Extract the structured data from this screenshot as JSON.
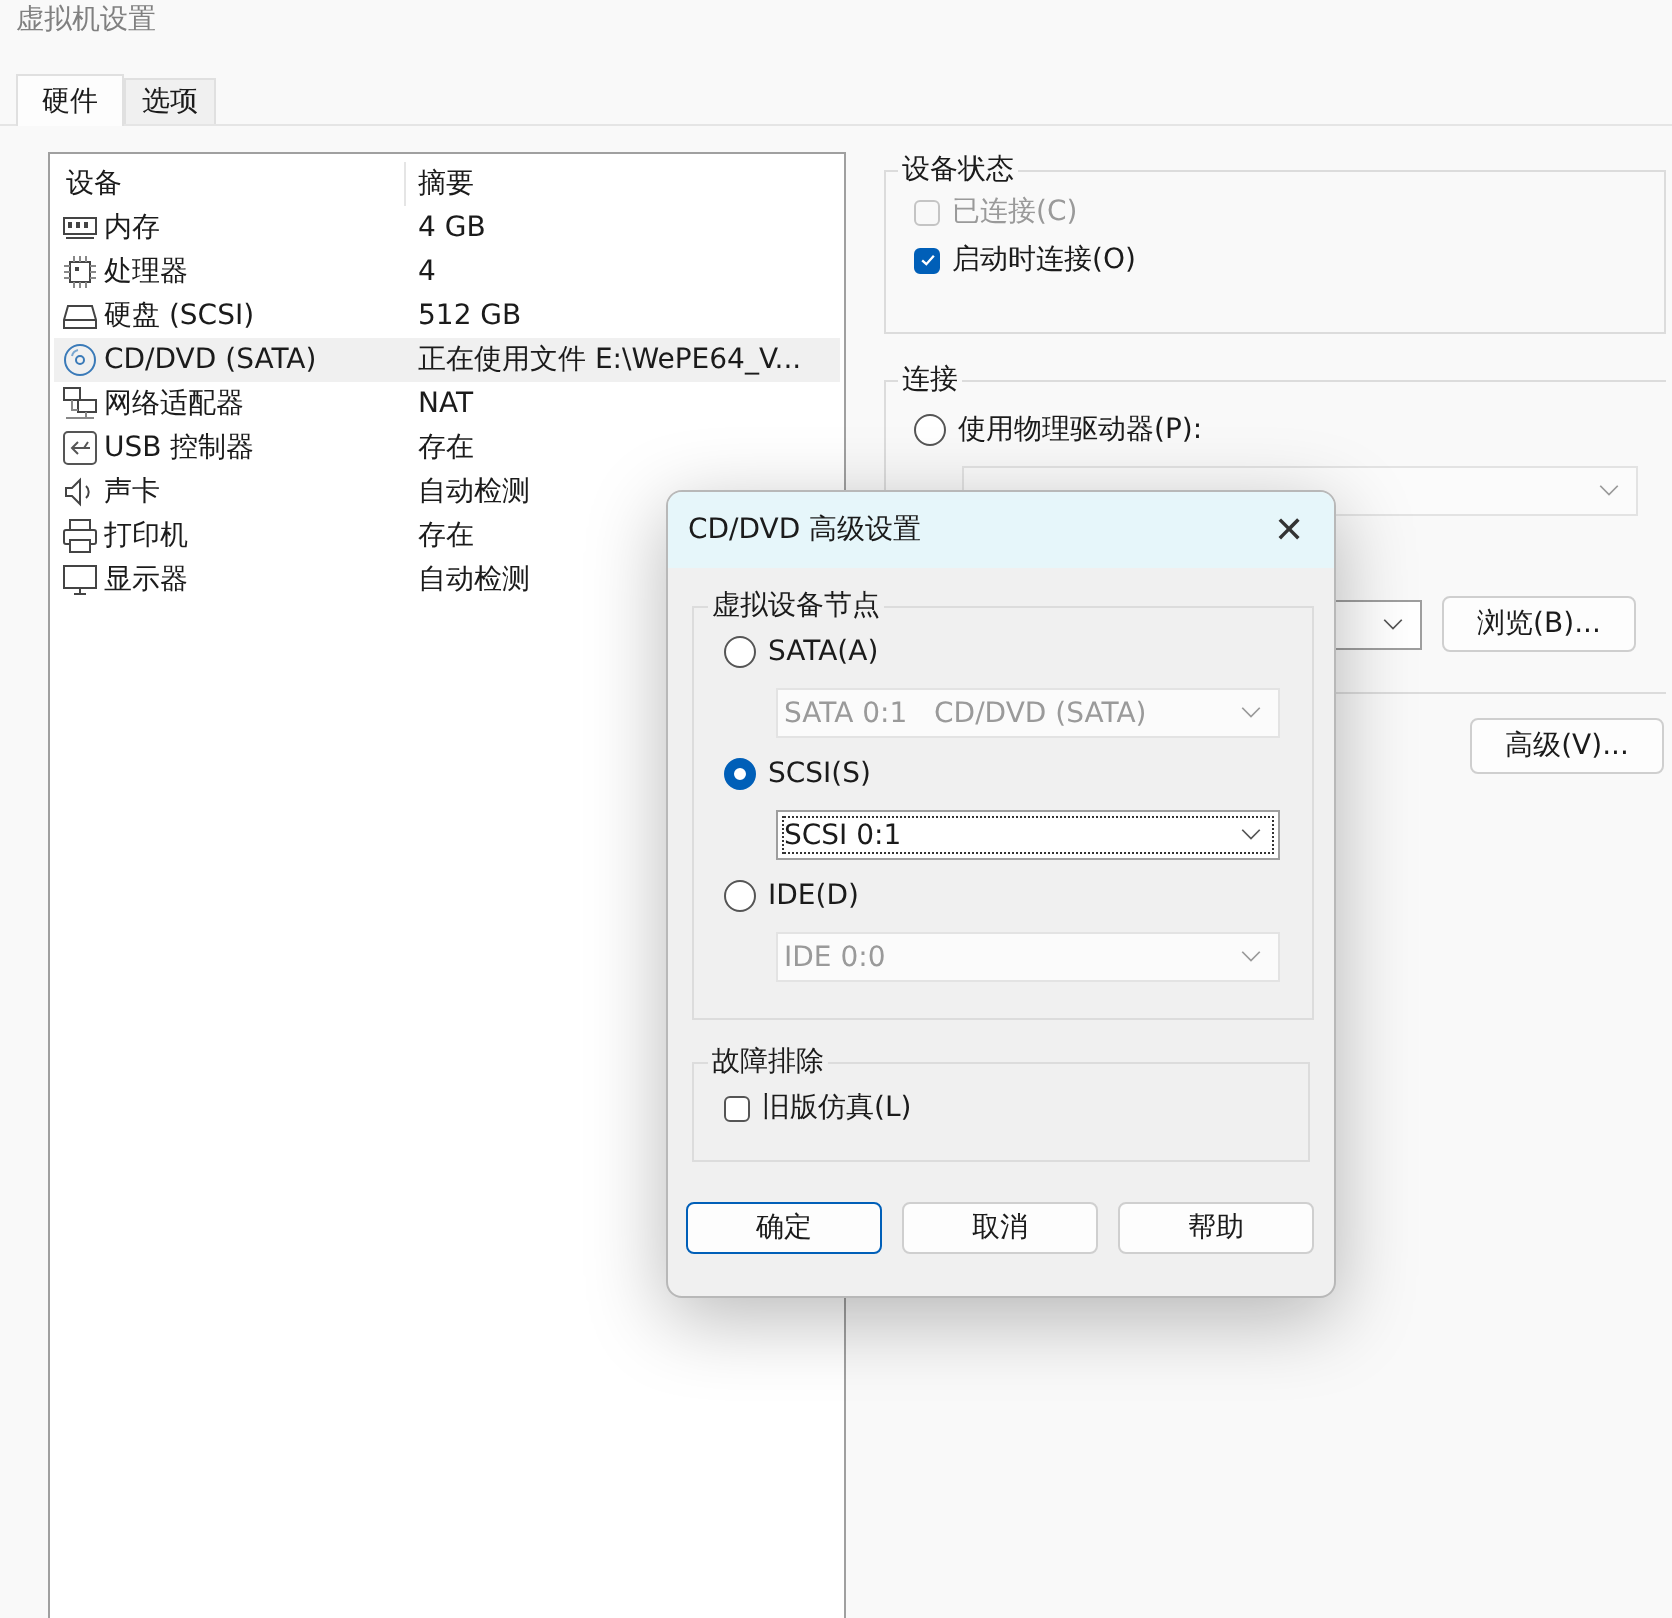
{
  "window": {
    "title": "虚拟机设置"
  },
  "tabs": [
    {
      "label": "硬件",
      "selected": true
    },
    {
      "label": "选项",
      "selected": false
    }
  ],
  "device_table": {
    "columns": [
      "设备",
      "摘要"
    ],
    "rows": [
      {
        "device": "内存",
        "summary": "4 GB",
        "selected": false
      },
      {
        "device": "处理器",
        "summary": "4",
        "selected": false
      },
      {
        "device": "硬盘 (SCSI)",
        "summary": "512 GB",
        "selected": false
      },
      {
        "device": "CD/DVD (SATA)",
        "summary": "正在使用文件 E:\\WePE64_V...",
        "selected": true
      },
      {
        "device": "网络适配器",
        "summary": "NAT",
        "selected": false
      },
      {
        "device": "USB 控制器",
        "summary": "存在",
        "selected": false
      },
      {
        "device": "声卡",
        "summary": "自动检测",
        "selected": false
      },
      {
        "device": "打印机",
        "summary": "存在",
        "selected": false
      },
      {
        "device": "显示器",
        "summary": "自动检测",
        "selected": false
      }
    ]
  },
  "device_status": {
    "title": "设备状态",
    "options": [
      {
        "label": "已连接(C)",
        "checked": false,
        "disabled": true
      },
      {
        "label": "启动时连接(O)",
        "checked": true,
        "disabled": false
      }
    ]
  },
  "connection": {
    "title": "连接",
    "physical_drive": {
      "label": "使用物理驱动器(P):",
      "selected": false
    },
    "drive_select": {
      "disabled": true
    },
    "browse_button": "浏览(B)..."
  },
  "advanced_button": "高级(V)...",
  "dialog": {
    "title": "CD/DVD 高级设置",
    "close": "✕",
    "node_group": {
      "title": "虚拟设备节点",
      "options": [
        {
          "label": "SATA(A)",
          "selected": false,
          "value": "SATA 0:1   CD/DVD (SATA)",
          "disabled": true
        },
        {
          "label": "SCSI(S)",
          "selected": true,
          "value": "SCSI 0:1",
          "disabled": false
        },
        {
          "label": "IDE(D)",
          "selected": false,
          "value": "IDE 0:0",
          "disabled": true
        }
      ]
    },
    "troubleshoot": {
      "title": "故障排除",
      "option": {
        "label": "旧版仿真(L)",
        "checked": false
      }
    },
    "buttons": [
      {
        "label": "确定",
        "default": true
      },
      {
        "label": "取消",
        "default": false
      },
      {
        "label": "帮助",
        "default": false
      }
    ]
  }
}
